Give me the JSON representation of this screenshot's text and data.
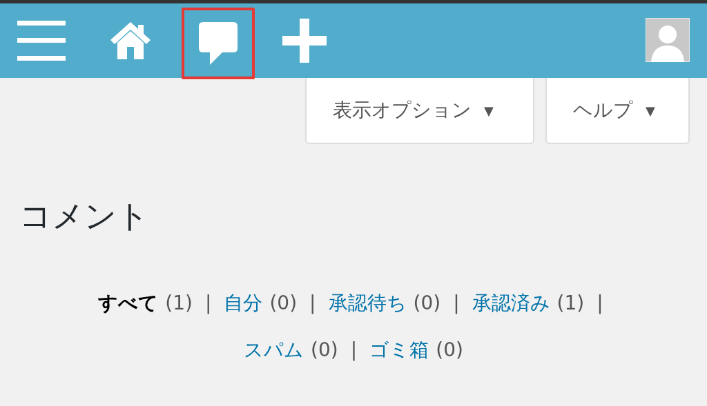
{
  "toolbar": {
    "items": [
      {
        "kind": "menu",
        "highlighted": false
      },
      {
        "kind": "home",
        "highlighted": false
      },
      {
        "kind": "comments",
        "highlighted": true
      },
      {
        "kind": "new",
        "highlighted": false
      }
    ]
  },
  "screen_options": [
    {
      "label": "表示オプション",
      "caret": "▼"
    },
    {
      "label": "ヘルプ",
      "caret": "▼"
    }
  ],
  "title": "コメント",
  "filter_rows": [
    [
      {
        "label": "すべて",
        "count": "(1)",
        "selected": true,
        "separator": "|"
      },
      {
        "label": "自分",
        "count": "(0)",
        "selected": false,
        "separator": "|"
      },
      {
        "label": "承認待ち",
        "count": "(0)",
        "selected": false,
        "separator": "|"
      },
      {
        "label": "承認済み",
        "count": "(1)",
        "selected": false,
        "separator": "|"
      }
    ],
    [
      {
        "label": "スパム",
        "count": "(0)",
        "selected": false,
        "separator": "|"
      },
      {
        "label": "ゴミ箱",
        "count": "(0)",
        "selected": false
      }
    ]
  ]
}
